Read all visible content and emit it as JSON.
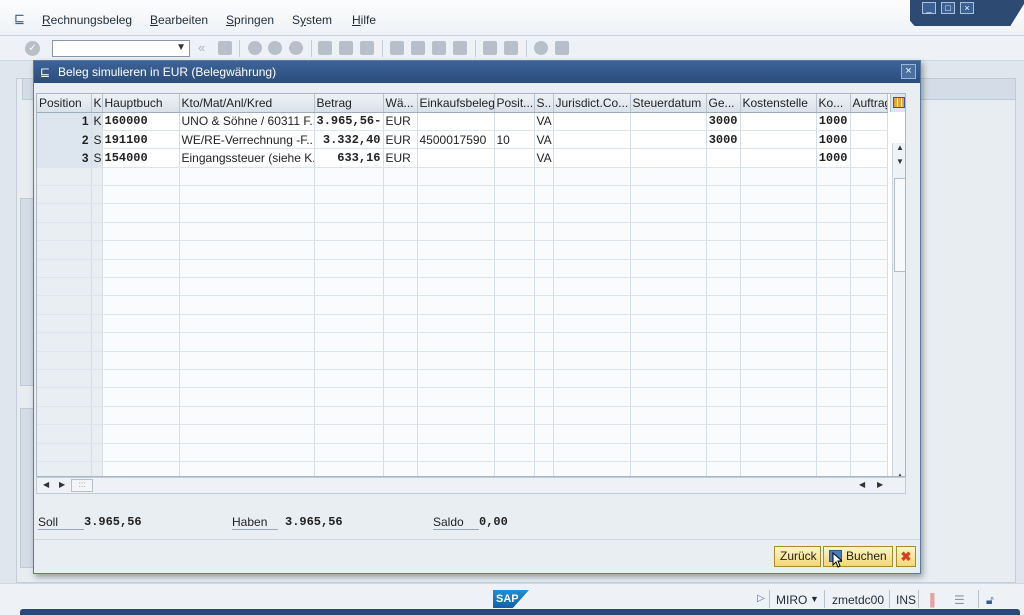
{
  "menu": {
    "items": [
      "Rechnungsbeleg",
      "Bearbeiten",
      "Springen",
      "System",
      "Hilfe"
    ],
    "underline": [
      "R",
      "B",
      "S",
      "y",
      "H"
    ]
  },
  "window": {
    "minimize": "_",
    "maximize": "□",
    "close": "×"
  },
  "dialog": {
    "title": "Beleg simulieren in EUR (Belegwährung)",
    "close": "×"
  },
  "table": {
    "headers": [
      "Position",
      "K",
      "Hauptbuch",
      "Kto/Mat/Anl/Kred",
      "Betrag",
      "Wä...",
      "Einkaufsbeleg",
      "Posit...",
      "S..",
      "Jurisdict.Co...",
      "Steuerdatum",
      "Ge...",
      "Kostenstelle",
      "Ko...",
      "Auftrag"
    ],
    "rows": [
      [
        "1",
        "K",
        "160000",
        "UNO & Söhne / 60311 F...",
        "3.965,56-",
        "EUR",
        "",
        "",
        "VA",
        "",
        "",
        "3000",
        "",
        "1000",
        ""
      ],
      [
        "2",
        "S",
        "191100",
        "WE/RE-Verrechnung -F...",
        "3.332,40",
        "EUR",
        "4500017590",
        "10",
        "VA",
        "",
        "",
        "3000",
        "",
        "1000",
        ""
      ],
      [
        "3",
        "S",
        "154000",
        "Eingangssteuer (siehe K...",
        "633,16",
        "EUR",
        "",
        "",
        "VA",
        "",
        "",
        "",
        "",
        "1000",
        ""
      ]
    ]
  },
  "totals": {
    "soll_label": "Soll",
    "soll_value": "3.965,56",
    "haben_label": "Haben",
    "haben_value": "3.965,56",
    "saldo_label": "Saldo",
    "saldo_value": "0,00"
  },
  "buttons": {
    "back": "Zurück",
    "post": "Buchen",
    "cancel": "✖"
  },
  "status": {
    "logo": "SAP",
    "transaction": "MIRO",
    "server": "zmetdc00",
    "mode": "INS"
  },
  "icons": [
    "document-icon",
    "checkmark-icon",
    "save-icon",
    "back-icon",
    "exit-icon",
    "cancel-icon",
    "print-icon",
    "find-icon",
    "find-next-icon",
    "first-page-icon",
    "prev-page-icon",
    "next-page-icon",
    "last-page-icon",
    "new-session-icon",
    "shortcut-icon",
    "help-icon",
    "customize-icon"
  ],
  "colors": {
    "title_bar": "#2b4d7c",
    "button_face": "#f4d874",
    "cancel_x": "#d2411c"
  }
}
